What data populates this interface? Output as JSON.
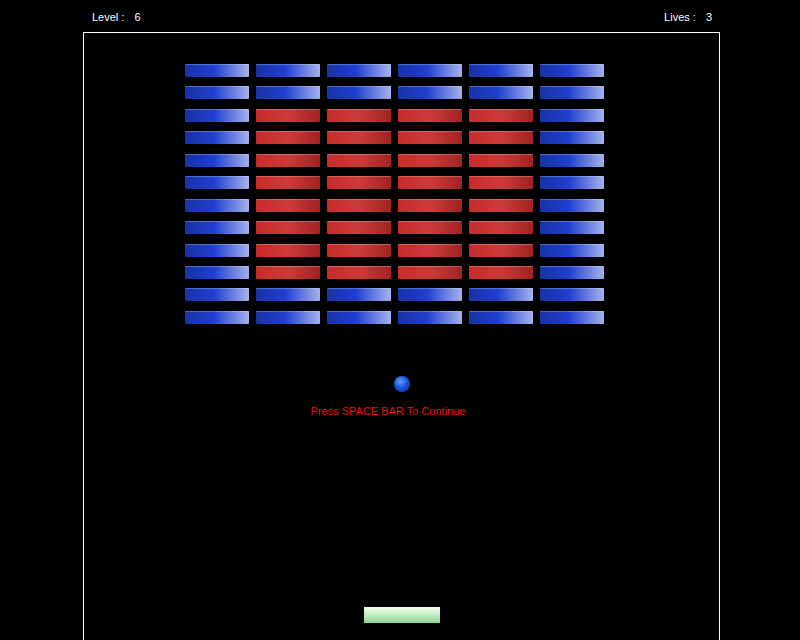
{
  "hud": {
    "level_label": "Level :",
    "level": "6",
    "lives_label": "Lives :",
    "lives": "3"
  },
  "bricks": [
    [
      {
        "color": "#1f3fcf"
      },
      {
        "color": "#1f3fcf"
      },
      {
        "color": "#1f3fcf"
      },
      {
        "color": "#1f3fcf"
      },
      {
        "color": "#1f3fcf"
      },
      {
        "color": "#1f3fcf"
      }
    ],
    [
      {
        "color": "#1f3fcf"
      },
      {
        "color": "#1f3fcf"
      },
      {
        "color": "#1f3fcf"
      },
      {
        "color": "#1f3fcf"
      },
      {
        "color": "#1f3fcf"
      },
      {
        "color": "#1f3fcf"
      }
    ],
    [
      {
        "color": "#1f3fcf"
      },
      {
        "color": "#c82a2a"
      },
      {
        "color": "#c82a2a"
      },
      {
        "color": "#c82a2a"
      },
      {
        "color": "#c82a2a"
      },
      {
        "color": "#1f3fcf"
      }
    ],
    [
      {
        "color": "#1f3fcf"
      },
      {
        "color": "#c82a2a"
      },
      {
        "color": "#c82a2a"
      },
      {
        "color": "#c82a2a"
      },
      {
        "color": "#c82a2a"
      },
      {
        "color": "#1f3fcf"
      }
    ],
    [
      {
        "color": "#1f3fcf"
      },
      {
        "color": "#c82a2a"
      },
      {
        "color": "#c82a2a"
      },
      {
        "color": "#c82a2a"
      },
      {
        "color": "#c82a2a"
      },
      {
        "color": "#1f3fcf"
      }
    ],
    [
      {
        "color": "#1f3fcf"
      },
      {
        "color": "#c82a2a"
      },
      {
        "color": "#c82a2a"
      },
      {
        "color": "#c82a2a"
      },
      {
        "color": "#c82a2a"
      },
      {
        "color": "#1f3fcf"
      }
    ],
    [
      {
        "color": "#1f3fcf"
      },
      {
        "color": "#c82a2a"
      },
      {
        "color": "#c82a2a"
      },
      {
        "color": "#c82a2a"
      },
      {
        "color": "#c82a2a"
      },
      {
        "color": "#1f3fcf"
      }
    ],
    [
      {
        "color": "#1f3fcf"
      },
      {
        "color": "#c82a2a"
      },
      {
        "color": "#c82a2a"
      },
      {
        "color": "#c82a2a"
      },
      {
        "color": "#c82a2a"
      },
      {
        "color": "#1f3fcf"
      }
    ],
    [
      {
        "color": "#1f3fcf"
      },
      {
        "color": "#c82a2a"
      },
      {
        "color": "#c82a2a"
      },
      {
        "color": "#c82a2a"
      },
      {
        "color": "#c82a2a"
      },
      {
        "color": "#1f3fcf"
      }
    ],
    [
      {
        "color": "#1f3fcf"
      },
      {
        "color": "#c82a2a"
      },
      {
        "color": "#c82a2a"
      },
      {
        "color": "#c82a2a"
      },
      {
        "color": "#c82a2a"
      },
      {
        "color": "#1f3fcf"
      }
    ],
    [
      {
        "color": "#1f3fcf"
      },
      {
        "color": "#1f3fcf"
      },
      {
        "color": "#1f3fcf"
      },
      {
        "color": "#1f3fcf"
      },
      {
        "color": "#1f3fcf"
      },
      {
        "color": "#1f3fcf"
      }
    ],
    [
      {
        "color": "#1f3fcf"
      },
      {
        "color": "#1f3fcf"
      },
      {
        "color": "#1f3fcf"
      },
      {
        "color": "#1f3fcf"
      },
      {
        "color": "#1f3fcf"
      },
      {
        "color": "#1f3fcf"
      }
    ]
  ],
  "message": "Press SPACE BAR To Continue"
}
